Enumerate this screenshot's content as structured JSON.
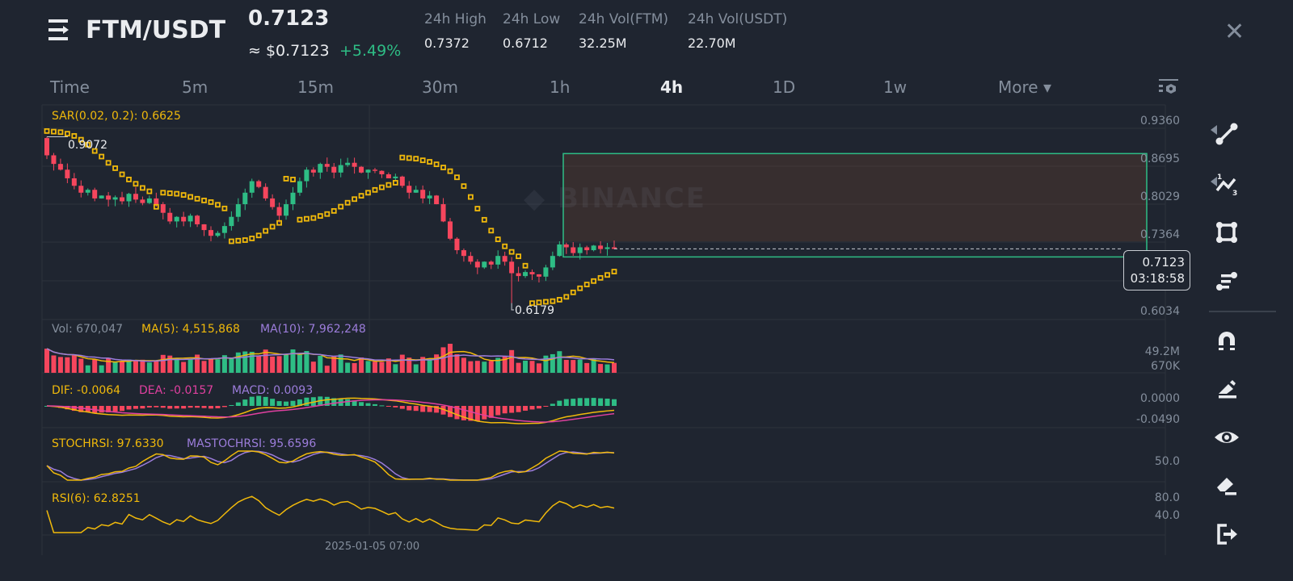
{
  "header": {
    "pair": "FTM/USDT",
    "last_price": "0.7123",
    "usd_price": "≈ $0.7123",
    "change": "+5.49%",
    "stats": [
      {
        "label": "24h High",
        "value": "0.7372"
      },
      {
        "label": "24h Low",
        "value": "0.6712"
      },
      {
        "label": "24h Vol(FTM)",
        "value": "32.25M"
      },
      {
        "label": "24h Vol(USDT)",
        "value": "22.70M"
      }
    ],
    "icons": {
      "menu": "menu-icon",
      "close": "close-icon"
    }
  },
  "timeframes": [
    {
      "label": "Time"
    },
    {
      "label": "5m"
    },
    {
      "label": "15m"
    },
    {
      "label": "30m"
    },
    {
      "label": "1h"
    },
    {
      "label": "4h",
      "active": true
    },
    {
      "label": "1D"
    },
    {
      "label": "1w"
    },
    {
      "label": "More ▾"
    }
  ],
  "toolbar": [
    "trend-line-icon",
    "fibonacci-icon",
    "rectangle-icon",
    "parallel-lines-icon",
    "magnet-icon",
    "pencil-icon",
    "eye-icon",
    "eraser-icon",
    "exit-icon"
  ],
  "colors": {
    "up": "#2ebd85",
    "down": "#f6465d",
    "sar": "#f0b90b",
    "ma5": "#f0b90b",
    "ma10": "#9c7ddb",
    "dea": "#e040a0",
    "bg": "#1f2530"
  },
  "chart_data": {
    "type": "candlestick",
    "interval": "4h",
    "watermark": "BINANCE",
    "price_axis": {
      "ticks": [
        "0.9360",
        "0.8695",
        "0.8029",
        "0.7364",
        "0.6034"
      ],
      "range": [
        0.6034,
        0.936
      ]
    },
    "current_price": {
      "value": "0.7123",
      "countdown": "03:18:58"
    },
    "high_label": "0.9072",
    "low_label": "0.6179",
    "x_label": "2025-01-05 07:00",
    "closes": [
      0.875,
      0.86,
      0.85,
      0.835,
      0.822,
      0.81,
      0.815,
      0.8,
      0.805,
      0.798,
      0.802,
      0.795,
      0.808,
      0.798,
      0.792,
      0.8,
      0.79,
      0.775,
      0.76,
      0.768,
      0.76,
      0.77,
      0.755,
      0.745,
      0.735,
      0.74,
      0.752,
      0.768,
      0.79,
      0.81,
      0.83,
      0.82,
      0.8,
      0.785,
      0.77,
      0.79,
      0.81,
      0.83,
      0.85,
      0.845,
      0.86,
      0.855,
      0.845,
      0.858,
      0.862,
      0.855,
      0.845,
      0.85,
      0.848,
      0.842,
      0.835,
      0.838,
      0.822,
      0.81,
      0.815,
      0.8,
      0.805,
      0.79,
      0.76,
      0.73,
      0.71,
      0.7,
      0.69,
      0.68,
      0.69,
      0.685,
      0.7,
      0.69,
      0.67,
      0.665,
      0.672,
      0.668,
      0.664,
      0.68,
      0.7,
      0.72,
      0.715,
      0.705,
      0.715,
      0.71,
      0.718,
      0.712,
      0.715,
      0.7123
    ],
    "first_open": 0.905,
    "rectangle": {
      "top": 0.878,
      "bottom": 0.7123
    },
    "indicators": {
      "sar": {
        "label": "SAR(0.02, 0.2): 0.6625"
      },
      "volume": {
        "label": "Vol: 670,047",
        "ma5": "MA(5): 4,515,868",
        "ma10": "MA(10): 7,962,248",
        "axis": [
          "49.2M",
          "670K"
        ]
      },
      "macd": {
        "dif": "DIF: -0.0064",
        "dea": "DEA: -0.0157",
        "macd": "MACD: 0.0093",
        "axis": [
          "0.0000",
          "-0.0490"
        ]
      },
      "stochrsi": {
        "k": "STOCHRSI: 97.6330",
        "d": "MASTOCHRSI: 95.6596",
        "axis": [
          "50.0"
        ]
      },
      "rsi": {
        "label": "RSI(6): 62.8251",
        "axis": [
          "80.0",
          "40.0"
        ]
      }
    }
  }
}
